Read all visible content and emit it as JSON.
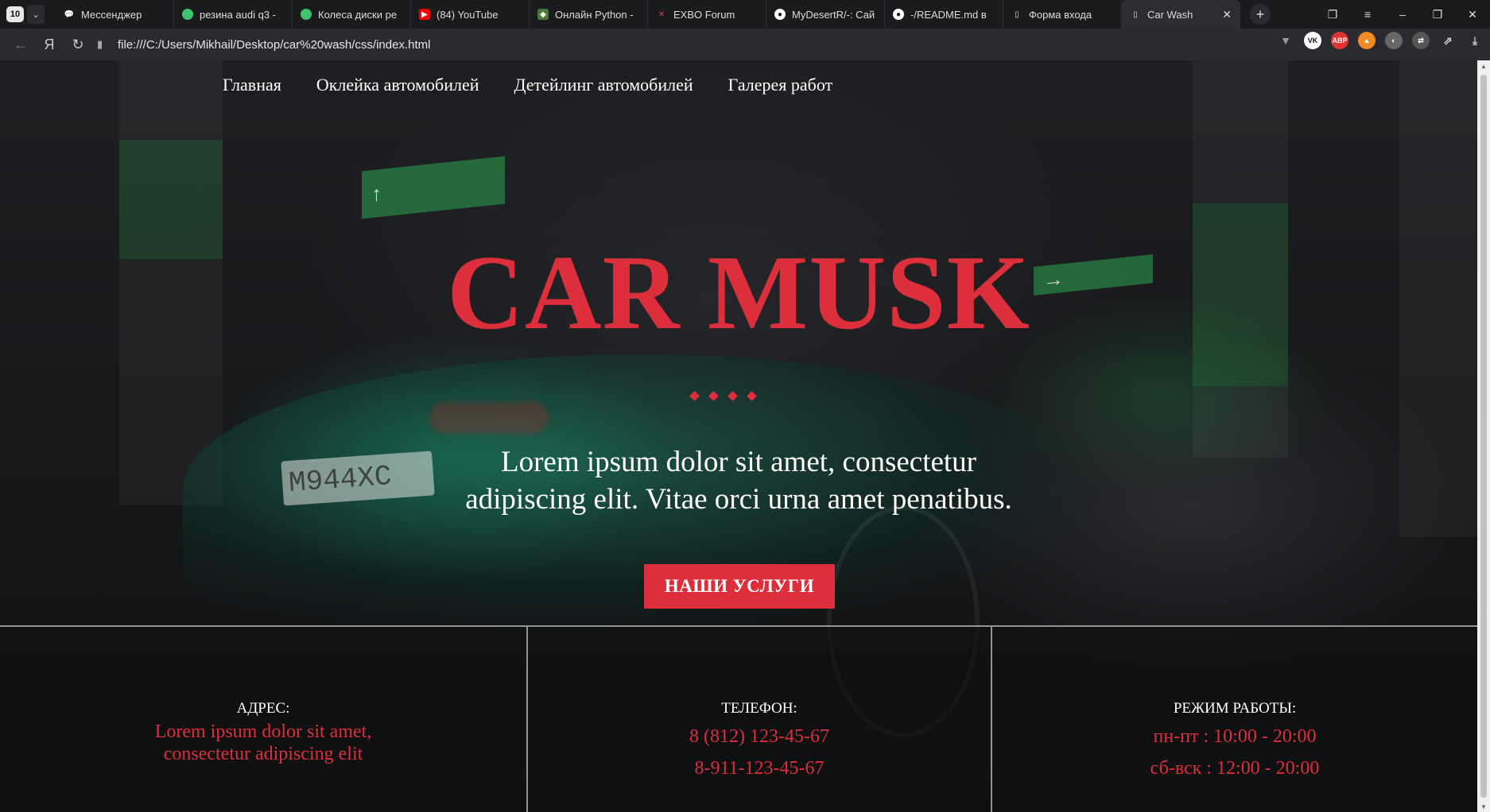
{
  "browser": {
    "tab_counter": "10",
    "tabs": [
      {
        "title": "Мессенджер",
        "icon": "messenger-icon",
        "color": "#ffffff"
      },
      {
        "title": "резина audi q3 -",
        "icon": "avito-icon",
        "color": "#3ec46d"
      },
      {
        "title": "Колеса диски ре",
        "icon": "avito-icon",
        "color": "#3ec46d"
      },
      {
        "title": "(84) YouTube",
        "icon": "youtube-icon",
        "color": "#ff0000"
      },
      {
        "title": "Онлайн Python -",
        "icon": "python-shield-icon",
        "color": "#f2c94c"
      },
      {
        "title": "EXBO Forum",
        "icon": "exbo-icon",
        "color": "#d84040"
      },
      {
        "title": "MyDesertR/-: Сай",
        "icon": "github-icon",
        "color": "#ffffff"
      },
      {
        "title": "-/README.md в",
        "icon": "github-icon",
        "color": "#ffffff"
      },
      {
        "title": "Форма входа",
        "icon": "document-icon",
        "color": "#ffffff"
      },
      {
        "title": "Car Wash",
        "icon": "document-icon",
        "color": "#ffffff"
      }
    ],
    "url": "file:///C:/Users/Mikhail/Desktop/car%20wash/css/index.html"
  },
  "nav": {
    "items": [
      "Главная",
      "Оклейка автомобилей",
      "Детейлинг автомобилей",
      "Галерея работ"
    ]
  },
  "hero": {
    "title": "CAR MUSK",
    "text_line1": "Lorem ipsum dolor sit amet, consectetur",
    "text_line2": "adipiscing elit. Vitae orci urna amet penatibus.",
    "button": "НАШИ УСЛУГИ",
    "accent_color": "#dc2f3b"
  },
  "backdrop": {
    "plate_text": "M944XC"
  },
  "info": {
    "address_label": "АДРЕС:",
    "address_line1": "Lorem ipsum dolor sit amet,",
    "address_line2": "consectetur adipiscing elit",
    "phone_label": "ТЕЛЕФОН:",
    "phone1": "8 (812) 123-45-67",
    "phone2": "8-911-123-45-67",
    "hours_label": "РЕЖИМ РАБОТЫ:",
    "hours1": "пн-пт : 10:00 - 20:00",
    "hours2": "сб-вск : 12:00 - 20:00"
  }
}
